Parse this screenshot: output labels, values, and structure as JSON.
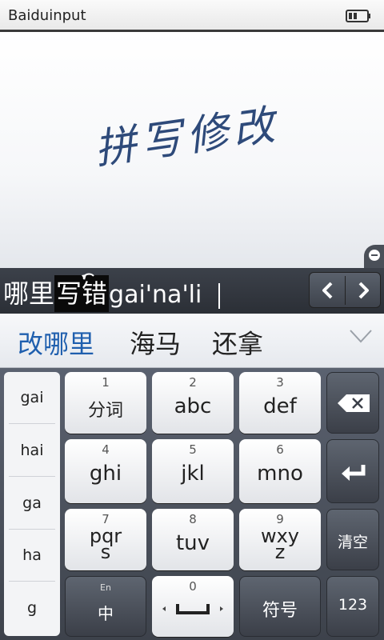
{
  "status_bar": {
    "title": "Baiduinput"
  },
  "handwriting": {
    "text": "拼写修改"
  },
  "composition": {
    "segments": [
      "哪里",
      "写错",
      " gai'na'li"
    ]
  },
  "candidates": [
    "改哪里",
    "海马",
    "还拿"
  ],
  "pinyin_list": [
    "gai",
    "hai",
    "ga",
    "ha",
    "g"
  ],
  "keys": [
    {
      "num": "1",
      "label": "分词"
    },
    {
      "num": "2",
      "label": "abc"
    },
    {
      "num": "3",
      "label": "def"
    },
    {
      "num": "4",
      "label": "ghi"
    },
    {
      "num": "5",
      "label": "jkl"
    },
    {
      "num": "6",
      "label": "mno"
    },
    {
      "num": "7",
      "label": "pqr\ns"
    },
    {
      "num": "8",
      "label": "tuv"
    },
    {
      "num": "9",
      "label": "wxy\nz"
    },
    {
      "num": "0",
      "label": ""
    }
  ],
  "side_keys": {
    "clear": "清空",
    "lang_small": "En",
    "lang": "中",
    "symbol": "符号",
    "num": "123"
  },
  "colors": {
    "accent": "#1f5fae",
    "keyboard_bg": "#4a505b",
    "handwriting": "#2e4a7a"
  },
  "icons": [
    "battery-icon",
    "undo-icon",
    "arrow-left-icon",
    "arrow-right-icon",
    "dropdown-icon",
    "backspace-icon",
    "enter-icon",
    "space-icon",
    "minimize-icon"
  ]
}
